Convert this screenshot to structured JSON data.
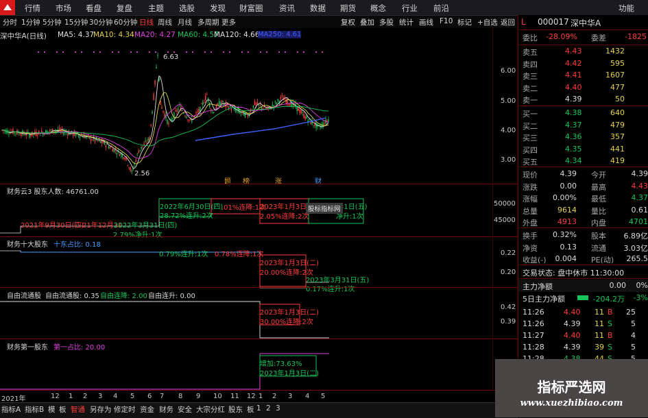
{
  "topbar": {
    "menu": [
      "行情",
      "市场",
      "看盘",
      "复盘",
      "主题",
      "选股",
      "发现",
      "财富圈",
      "资讯",
      "数据",
      "期货",
      "概念",
      "行业",
      "前沿"
    ],
    "right": "功能"
  },
  "toolbar": {
    "periods": [
      "分时",
      "1分钟",
      "5分钟",
      "15分钟",
      "30分钟",
      "60分钟",
      "日线",
      "周线",
      "月线",
      "多周期",
      "更多"
    ],
    "active_period": "日线",
    "right_tools": [
      "复权",
      "叠加",
      "多股",
      "统计",
      "画线",
      "F10",
      "标记",
      "+自选",
      "返回"
    ]
  },
  "main_chart": {
    "title": "深中华A(日线)",
    "ma": [
      {
        "label": "MA5: 4.37",
        "color": "#e0e0e0"
      },
      {
        "label": "MA10: 4.34",
        "color": "#e6d44a"
      },
      {
        "label": "MA20: 4.27",
        "color": "#e040e0"
      },
      {
        "label": "MA60: 4.57",
        "color": "#19c55a"
      },
      {
        "label": "MA120: 4.66",
        "color": "#e0e0e0"
      }
    ],
    "ma_extra": "MA250: 4.61",
    "high_label": "6.63",
    "low_label": "2.56",
    "price_ticks": [
      "6.00",
      "5.00",
      "4.00",
      "3.00"
    ],
    "event_marks": [
      "题",
      "榜",
      "涨",
      "财"
    ]
  },
  "panel_shareholders": {
    "title": "财务云3 股东人数: 46761.00",
    "axis": [
      "50000",
      "45000"
    ],
    "notes": [
      {
        "text": "2021年9月30日(四)",
        "color": "#ff3d3d"
      },
      {
        "text": "21年12月31",
        "color": "#ff3d3d"
      },
      {
        "text": "2022年3月31日(四)",
        "color": "#19c55a"
      },
      {
        "text": "2.79%净升:1次",
        "color": "#19c55a"
      },
      {
        "text": "2022年6月30日(四)",
        "color": "#19c55a"
      },
      {
        "text": "28.72%连升:2次",
        "color": "#19c55a"
      },
      {
        "text": ".01%连降:1次",
        "color": "#ff3d3d"
      },
      {
        "text": "2023年1月3日(二)",
        "color": "#ff3d3d"
      },
      {
        "text": "2.05%连降:2次",
        "color": "#ff3d3d"
      },
      {
        "text": "31日(五)",
        "color": "#19c55a"
      },
      {
        "text": "净升:1次",
        "color": "#19c55a"
      }
    ],
    "tooltip": "股标指标网"
  },
  "panel_top10": {
    "title": "财务十大股东",
    "value": "十东占比: 0.18",
    "axis": [
      "0.22",
      "0.20"
    ],
    "notes": [
      {
        "text": "0.79%连升:1次",
        "color": "#19c55a"
      },
      {
        "text": "0.78%连降:1次",
        "color": "#ff3d3d"
      },
      {
        "text": "2023年1月3日(二)",
        "color": "#ff3d3d"
      },
      {
        "text": "20.00%连降:2次",
        "color": "#ff3d3d"
      },
      {
        "text": "2023年3月31日(五)",
        "color": "#19c55a"
      },
      {
        "text": "0.17%连升:1次",
        "color": "#19c55a"
      }
    ]
  },
  "panel_float": {
    "title": "自由流通股",
    "v1": "自由流通股: 0.35",
    "v2": "自由连降: 2.00",
    "v3": "自由连升: 0.00",
    "axis": [
      "0.42",
      "0.39"
    ],
    "notes": [
      {
        "text": "2023年1月3日(二)",
        "color": "#ff3d3d"
      },
      {
        "text": "30.00%连降:2次",
        "color": "#ff3d3d"
      }
    ]
  },
  "panel_first": {
    "title": "财务第一股东",
    "value": "第一占比: 20.00",
    "notes": [
      {
        "text": "增加:73.63%",
        "color": "#19c55a"
      },
      {
        "text": "2023年1月3日(二)",
        "color": "#19c55a"
      }
    ]
  },
  "xaxis": {
    "year": "2021年",
    "months": [
      "12",
      "1",
      "2",
      "3",
      "4",
      "5",
      "6",
      "7",
      "8",
      "9",
      "10",
      "11",
      "12",
      "1",
      "2",
      "3",
      "4",
      "5"
    ]
  },
  "bottom_tabs": [
    "指标A",
    "指标B",
    "模",
    "板",
    "智通",
    "另存为",
    "修定时",
    "资金",
    "财务",
    "安全",
    "大宗分红",
    "股东",
    "板",
    "1",
    "2",
    "3"
  ],
  "active_tab": "智通",
  "quote": {
    "flag": "L",
    "code": "000017",
    "name": "深中华A",
    "weibi_label": "委比",
    "weibi": "-28.09%",
    "weicha_label": "委差",
    "weicha": "-1825",
    "asks": [
      {
        "label": "卖五",
        "price": "4.43",
        "vol": "1432"
      },
      {
        "label": "卖四",
        "price": "4.42",
        "vol": "595"
      },
      {
        "label": "卖三",
        "price": "4.41",
        "vol": "1607"
      },
      {
        "label": "卖二",
        "price": "4.40",
        "vol": "477"
      },
      {
        "label": "卖一",
        "price": "4.39",
        "vol": "50"
      }
    ],
    "bids": [
      {
        "label": "买一",
        "price": "4.38",
        "vol": "640"
      },
      {
        "label": "买二",
        "price": "4.37",
        "vol": "479"
      },
      {
        "label": "买三",
        "price": "4.36",
        "vol": "357"
      },
      {
        "label": "买四",
        "price": "4.35",
        "vol": "441"
      },
      {
        "label": "买五",
        "price": "4.34",
        "vol": "419"
      }
    ],
    "stats": [
      {
        "l1": "现价",
        "v1": "4.39",
        "l2": "今开",
        "v2": "4.39",
        "c1": "white",
        "c2": "white"
      },
      {
        "l1": "涨跌",
        "v1": "0.00",
        "l2": "最高",
        "v2": "4.43",
        "c1": "white",
        "c2": "red"
      },
      {
        "l1": "涨幅",
        "v1": "0.00%",
        "l2": "最低",
        "v2": "4.37",
        "c1": "white",
        "c2": "green"
      },
      {
        "l1": "总量",
        "v1": "9614",
        "l2": "量比",
        "v2": "0.61",
        "c1": "yellow",
        "c2": "white"
      },
      {
        "l1": "外盘",
        "v1": "4913",
        "l2": "内盘",
        "v2": "4701",
        "c1": "red",
        "c2": "green"
      }
    ],
    "stats2": [
      {
        "l1": "换手",
        "v1": "0.32%",
        "l2": "股本",
        "v2": "6.89亿"
      },
      {
        "l1": "净资",
        "v1": "0.13",
        "l2": "流通",
        "v2": "3.03亿"
      },
      {
        "l1": "收益(-)",
        "v1": "0.004",
        "l2": "PE(动)",
        "v2": "265.5"
      }
    ],
    "trade_status": "交易状态: 盘中休市 11:30:00",
    "main_net_label": "主力净额",
    "main_net_vals": [
      "0.00",
      "0%"
    ],
    "five_day_label": "5日主力净额",
    "five_day_vals": [
      "-204.2万",
      "-3%"
    ],
    "ticks": [
      {
        "t": "11:26",
        "p": "4.40",
        "v": "11",
        "s": "B",
        "n": "25",
        "pc": "red",
        "sc": "red"
      },
      {
        "t": "11:26",
        "p": "4.39",
        "v": "11",
        "s": "S",
        "n": "5",
        "pc": "white",
        "sc": "green"
      },
      {
        "t": "11:27",
        "p": "4.40",
        "v": "11",
        "s": "B",
        "n": "4",
        "pc": "red",
        "sc": "red"
      },
      {
        "t": "11:28",
        "p": "4.39",
        "v": "39",
        "s": "S",
        "n": "5",
        "pc": "white",
        "sc": "green"
      },
      {
        "t": "11:28",
        "p": "4.38",
        "v": "44",
        "s": "S",
        "n": "5",
        "pc": "green",
        "sc": "green"
      }
    ]
  },
  "watermark": {
    "title": "指标严选网",
    "url": "www.xuezhibiao.com"
  },
  "colors": {
    "up": "#ff3d3d",
    "down": "#19c55a",
    "ma10": "#e6d44a",
    "ma20": "#e040e0",
    "ma60": "#19c55a",
    "separator": "#7a0000"
  }
}
